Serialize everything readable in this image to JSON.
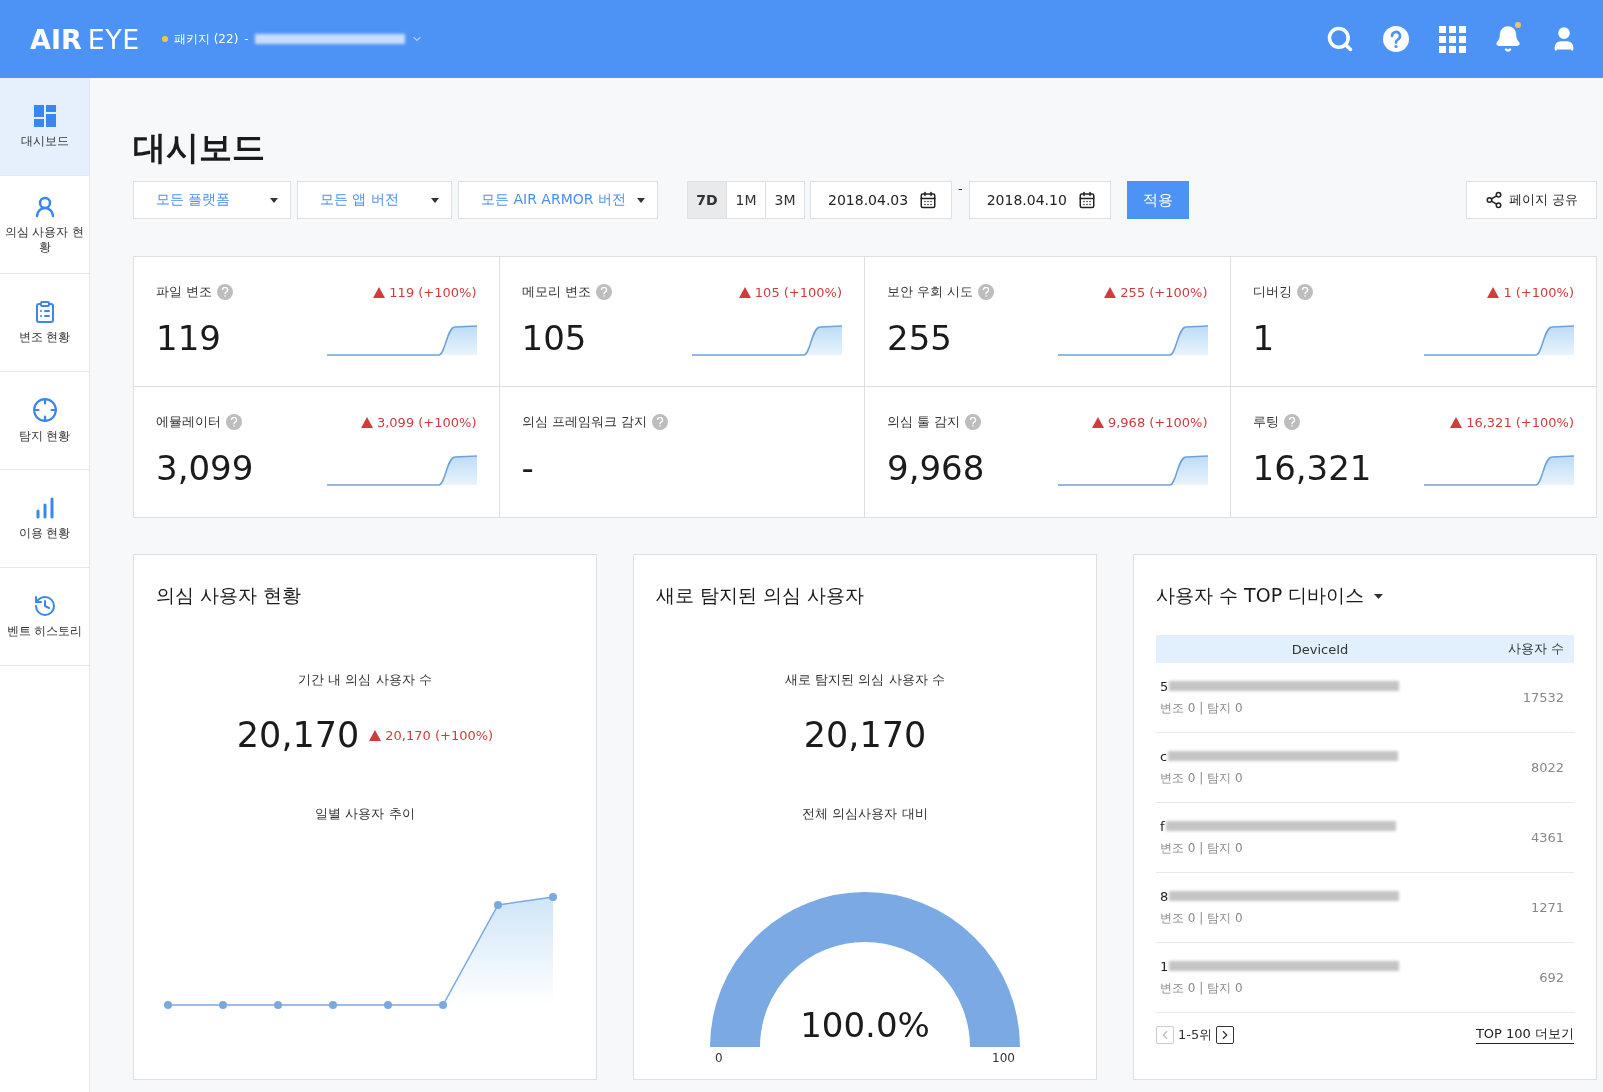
{
  "header": {
    "logo_bold": "AIR",
    "logo_light": "EYE",
    "package_label": "패키지 (22)",
    "package_separator": "-",
    "notification": true
  },
  "sidebar": {
    "items": [
      {
        "label": "대시보드",
        "selected": true
      },
      {
        "label": "의심 사용자 현황",
        "selected": false
      },
      {
        "label": "변조 현황",
        "selected": false
      },
      {
        "label": "탐지 현황",
        "selected": false
      },
      {
        "label": "이용 현황",
        "selected": false
      },
      {
        "label": "벤트 히스토리",
        "selected": false
      }
    ]
  },
  "page": {
    "title": "대시보드"
  },
  "filters": {
    "dropdowns": [
      "모든 플랫폼",
      "모든 앱 버전",
      "모든 AIR ARMOR 버전"
    ],
    "ranges": [
      {
        "label": "7D",
        "selected": true
      },
      {
        "label": "1M",
        "selected": false
      },
      {
        "label": "3M",
        "selected": false
      }
    ],
    "start_date": "2018.04.03",
    "date_separator": "-",
    "end_date": "2018.04.10",
    "apply": "적용",
    "share": "페이지 공유"
  },
  "metrics": [
    {
      "label": "파일 변조",
      "value": "119",
      "delta": "119 (+100%)"
    },
    {
      "label": "메모리 변조",
      "value": "105",
      "delta": "105 (+100%)"
    },
    {
      "label": "보안 우회 시도",
      "value": "255",
      "delta": "255 (+100%)"
    },
    {
      "label": "디버깅",
      "value": "1",
      "delta": "1 (+100%)"
    },
    {
      "label": "에뮬레이터",
      "value": "3,099",
      "delta": "3,099 (+100%)"
    },
    {
      "label": "의심 프레임워크 감지",
      "value": "-"
    },
    {
      "label": "의심 툴 감지",
      "value": "9,968",
      "delta": "9,968 (+100%)"
    },
    {
      "label": "루팅",
      "value": "16,321",
      "delta": "16,321 (+100%)"
    }
  ],
  "suspect_users": {
    "title": "의심 사용자 현황",
    "count_label": "기간 내 의심 사용자 수",
    "count": "20,170",
    "delta": "20,170 (+100%)",
    "chart_label": "일별 사용자 추이"
  },
  "new_suspects": {
    "title": "새로 탐지된 의심 사용자",
    "count_label": "새로 탐지된 의심 사용자 수",
    "count": "20,170",
    "gauge_label": "전체 의심사용자 대비",
    "gauge": {
      "reading": "100.0%",
      "min": "0",
      "max": "100"
    }
  },
  "top_devices": {
    "title": "사용자 수 TOP 디바이스",
    "columns": [
      "DeviceId",
      "사용자 수"
    ],
    "rows": [
      {
        "device_id": "5",
        "detail": "변조 0 | 탐지 0",
        "users": "17532"
      },
      {
        "device_id": "c",
        "detail": "변조 0 | 탐지 0",
        "users": "8022"
      },
      {
        "device_id": "f",
        "detail": "변조 0 | 탐지 0",
        "users": "4361"
      },
      {
        "device_id": "8",
        "detail": "변조 0 | 탐지 0",
        "users": "1271"
      },
      {
        "device_id": "1",
        "detail": "변조 0 | 탐지 0",
        "users": "692"
      }
    ],
    "pager": {
      "label": "1-5위",
      "prev_disabled": true,
      "next_disabled": false
    },
    "more": "TOP 100 더보기"
  }
}
